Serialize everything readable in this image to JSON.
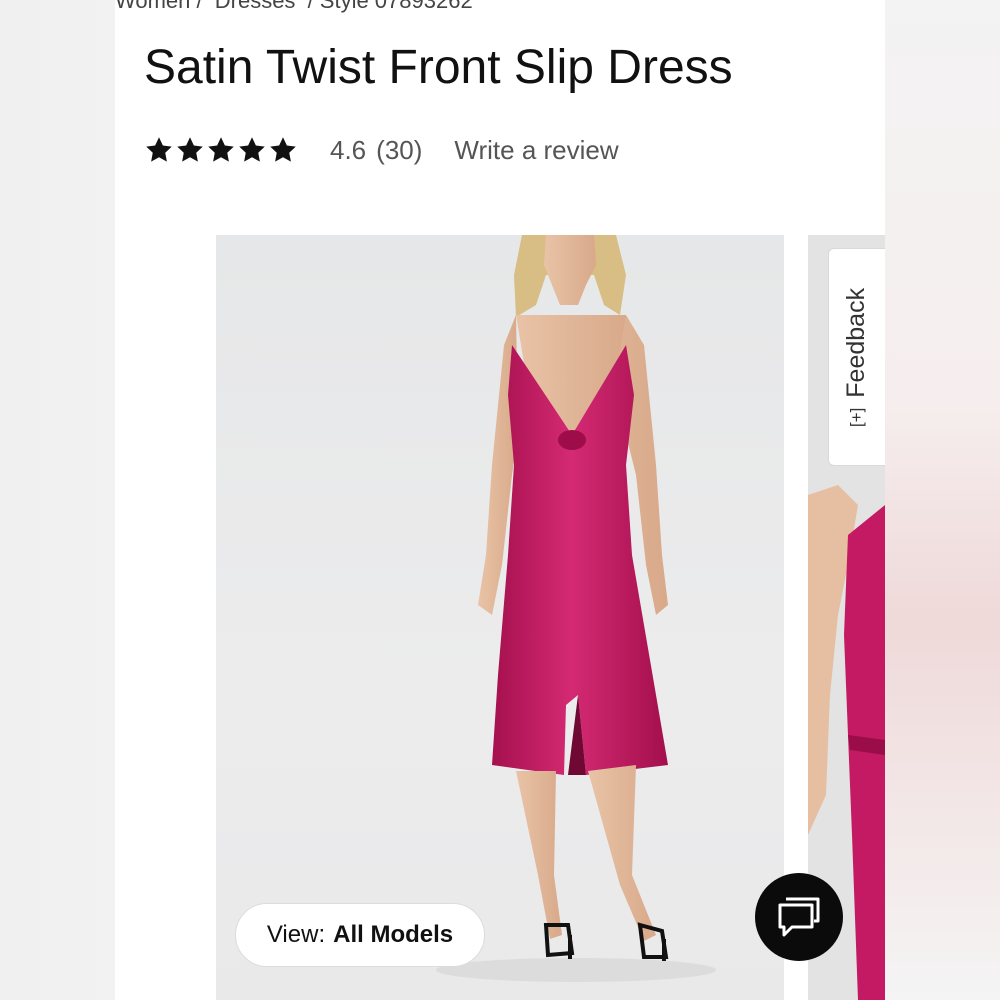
{
  "breadcrumb": [
    "Women /",
    "Dresses",
    "/ Style 07893262"
  ],
  "product": {
    "title": "Satin Twist Front Slip Dress",
    "rating": 4.6,
    "stars_filled": 5,
    "rating_value": "4.6",
    "review_count": "(30)",
    "write_review": "Write a review"
  },
  "image_view": {
    "prefix": "View:",
    "value": "All Models"
  },
  "feedback": {
    "icon_text": "[+]",
    "label": "Feedback"
  },
  "icons": {
    "star": "star-icon",
    "chat": "chat-bubbles-icon",
    "feedback": "plus-bracket-icon"
  },
  "colors": {
    "dress": "#c0185f",
    "text": "#111111",
    "chat_button": "#0b0b0b"
  }
}
